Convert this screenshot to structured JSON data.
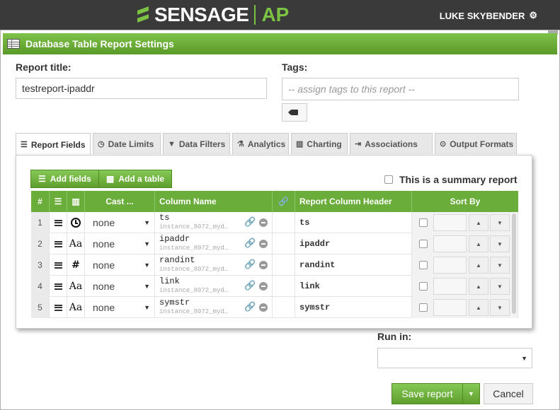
{
  "brand": {
    "name": "SENSAGE",
    "product": "AP"
  },
  "user": {
    "name": "LUKE SKYBENDER"
  },
  "window": {
    "title": "Database Table Report Settings"
  },
  "form": {
    "report_title_label": "Report title:",
    "report_title_value": "testreport-ipaddr",
    "tags_label": "Tags:",
    "tags_placeholder": "-- assign tags to this report --"
  },
  "tabs": [
    {
      "label": "Report Fields",
      "icon": "list-icon",
      "active": true
    },
    {
      "label": "Date Limits",
      "icon": "clock-icon"
    },
    {
      "label": "Data Filters",
      "icon": "filter-icon"
    },
    {
      "label": "Analytics",
      "icon": "flask-icon"
    },
    {
      "label": "Charting",
      "icon": "chart-icon"
    },
    {
      "label": "Associations",
      "icon": "associations-icon"
    },
    {
      "label": "Output Formats",
      "icon": "output-icon"
    }
  ],
  "panel": {
    "add_fields": "Add fields",
    "add_table": "Add a table",
    "summary_label": "This is a summary report",
    "summary_checked": false
  },
  "grid": {
    "headers": {
      "num": "#",
      "cast": "Cast ...",
      "column_name": "Column Name",
      "report_column_header": "Report Column Header",
      "sort_by": "Sort By"
    },
    "rows": [
      {
        "num": "1",
        "type": "clock-icon",
        "cast": "none",
        "column": "ts",
        "source": "instance_8072_myd…",
        "header": "ts"
      },
      {
        "num": "2",
        "type": "text-type-icon",
        "type_glyph": "Aa",
        "cast": "none",
        "column": "ipaddr",
        "source": "instance_8072_myd…",
        "header": "ipaddr"
      },
      {
        "num": "3",
        "type": "number-type-icon",
        "type_glyph": "#",
        "cast": "none",
        "column": "randint",
        "source": "instance_8072_myd…",
        "header": "randint"
      },
      {
        "num": "4",
        "type": "text-type-icon",
        "type_glyph": "Aa",
        "cast": "none",
        "column": "link",
        "source": "instance_8072_myd…",
        "header": "link"
      },
      {
        "num": "5",
        "type": "text-type-icon",
        "type_glyph": "Aa",
        "cast": "none",
        "column": "symstr",
        "source": "instance_8072_myd…",
        "header": "symstr"
      }
    ]
  },
  "run_in": {
    "label": "Run in:",
    "value": ""
  },
  "actions": {
    "save": "Save report",
    "cancel": "Cancel"
  },
  "colors": {
    "accent": "#6aad3a",
    "topbar": "#3a3a3a",
    "brand_green": "#7cc243"
  }
}
